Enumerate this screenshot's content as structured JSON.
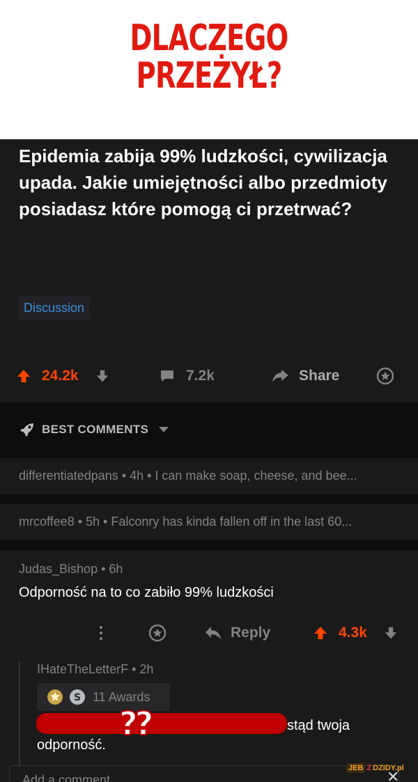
{
  "meme": {
    "title_line1": "DLACZEGO",
    "title_line2": "PRZEŻYŁ?"
  },
  "post": {
    "title": "Epidemia zabija 99% ludzkości, cywilizacja upada. Jakie umiejętności albo przedmioty posiadasz które pomogą ci przetrwać?",
    "flair": "Discussion",
    "upvotes": "24.2k",
    "comments": "7.2k",
    "share_label": "Share"
  },
  "sort": {
    "label": "BEST COMMENTS"
  },
  "collapsed_comments": [
    {
      "text": "differentiatedpans • 4h • I can make soap, cheese, and bee..."
    },
    {
      "text": "mrcoffee8 • 5h • Falconry has kinda fallen off in the last 60..."
    }
  ],
  "comment": {
    "meta": "Judas_Bishop • 6h",
    "body": "Odporność na to co zabiło 99% ludzkości",
    "reply_label": "Reply",
    "score": "4.3k"
  },
  "reply": {
    "meta": "IHateTheLetterF • 2h",
    "awards": "11 Awards",
    "censor_overlay": "??",
    "body_line1": "stąd twoja",
    "body_line2": "odporność."
  },
  "input": {
    "placeholder": "Add a comment"
  },
  "watermark": {
    "part1": "JEB",
    "part2": "Z",
    "part3": "DZIDY.pl"
  },
  "colors": {
    "accent": "#ff4500",
    "meme_red": "#e11a10",
    "flair_blue": "#3d8ddb",
    "background": "#1a1a1b"
  }
}
